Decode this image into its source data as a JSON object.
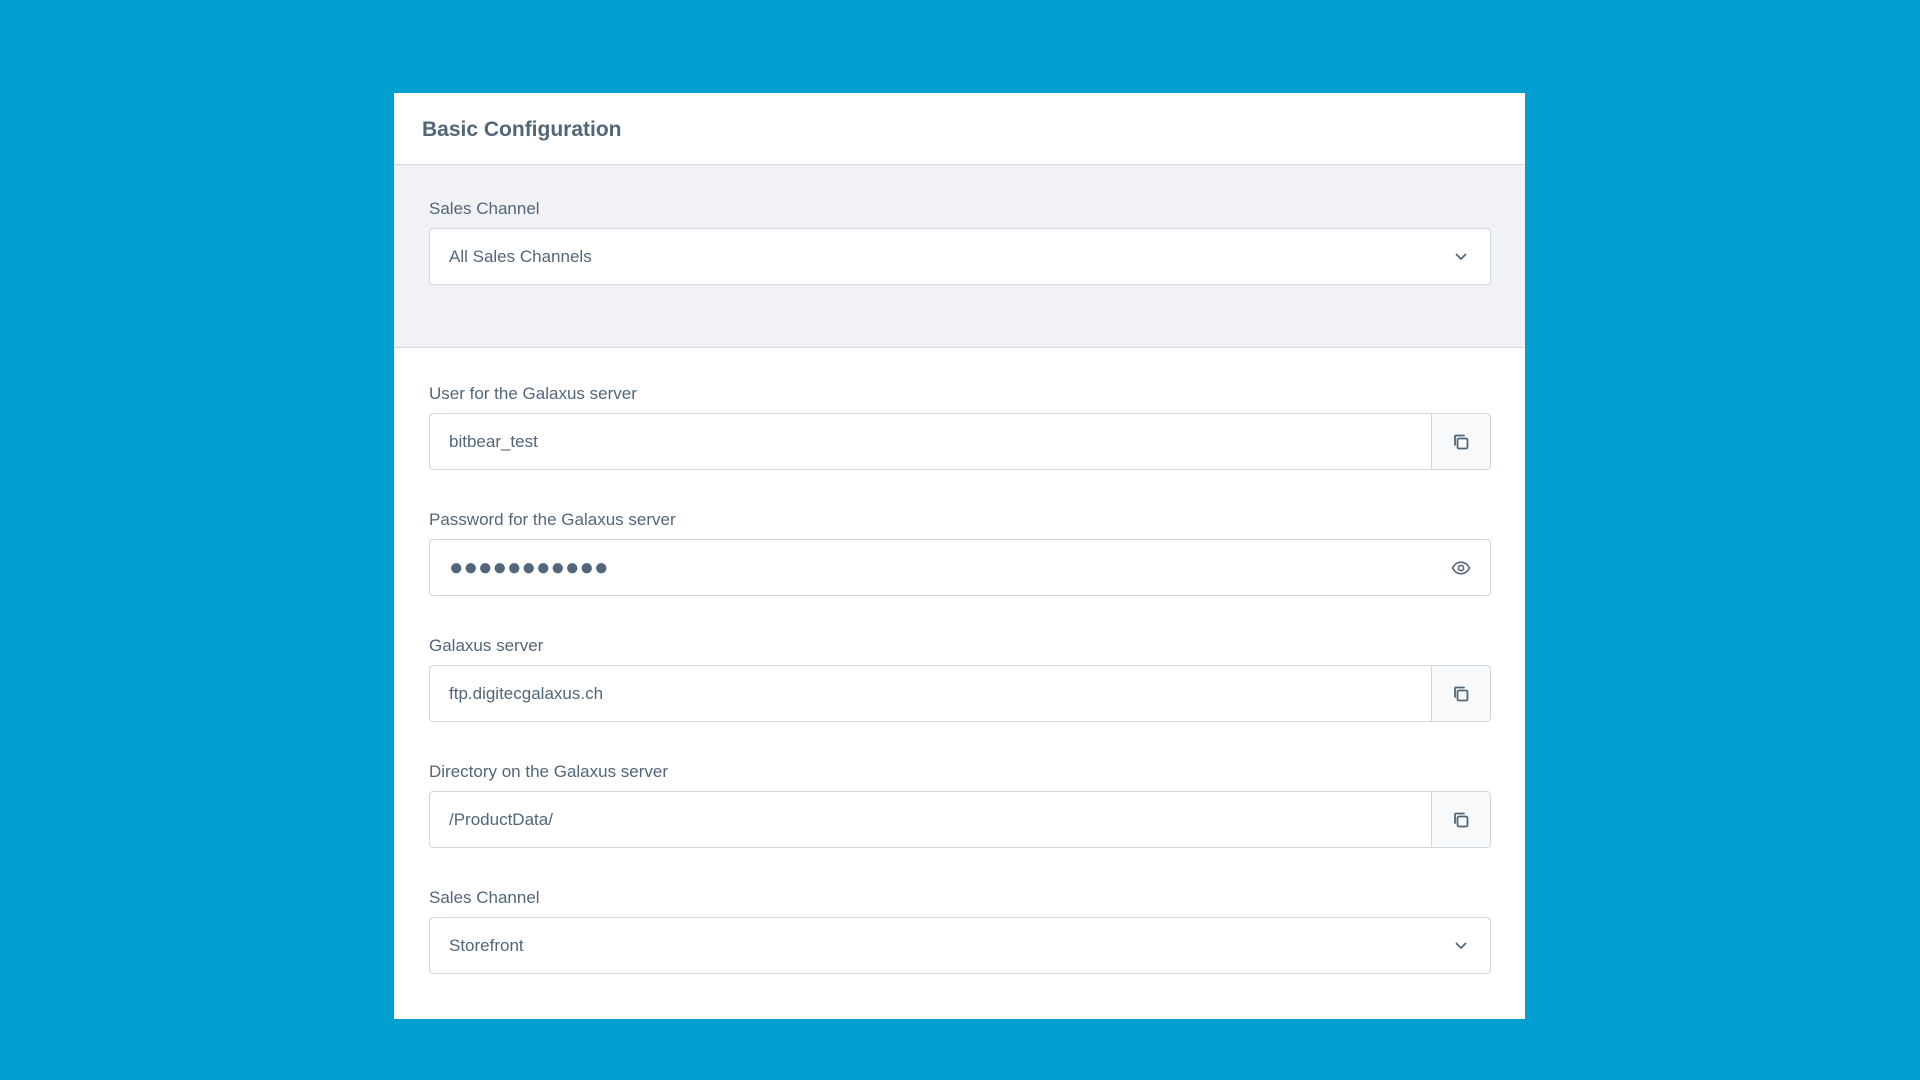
{
  "card": {
    "title": "Basic Configuration"
  },
  "sales_channel_filter": {
    "label": "Sales Channel",
    "value": "All Sales Channels"
  },
  "fields": {
    "user": {
      "label": "User for the Galaxus server",
      "value": "bitbear_test",
      "action_icon": "copy-icon"
    },
    "password": {
      "label": "Password for the Galaxus server",
      "value": "●●●●●●●●●●●",
      "action_icon": "eye-icon"
    },
    "server": {
      "label": "Galaxus server",
      "value": "ftp.digitecgalaxus.ch",
      "action_icon": "copy-icon"
    },
    "directory": {
      "label": "Directory on the Galaxus server",
      "value": "/ProductData/",
      "action_icon": "copy-icon"
    },
    "sales_channel": {
      "label": "Sales Channel",
      "value": "Storefront"
    }
  },
  "colors": {
    "background": "#009fd0",
    "card": "#ffffff",
    "section_bg": "#f0f2f5",
    "border": "#d1d9e0",
    "text": "#52667a"
  }
}
